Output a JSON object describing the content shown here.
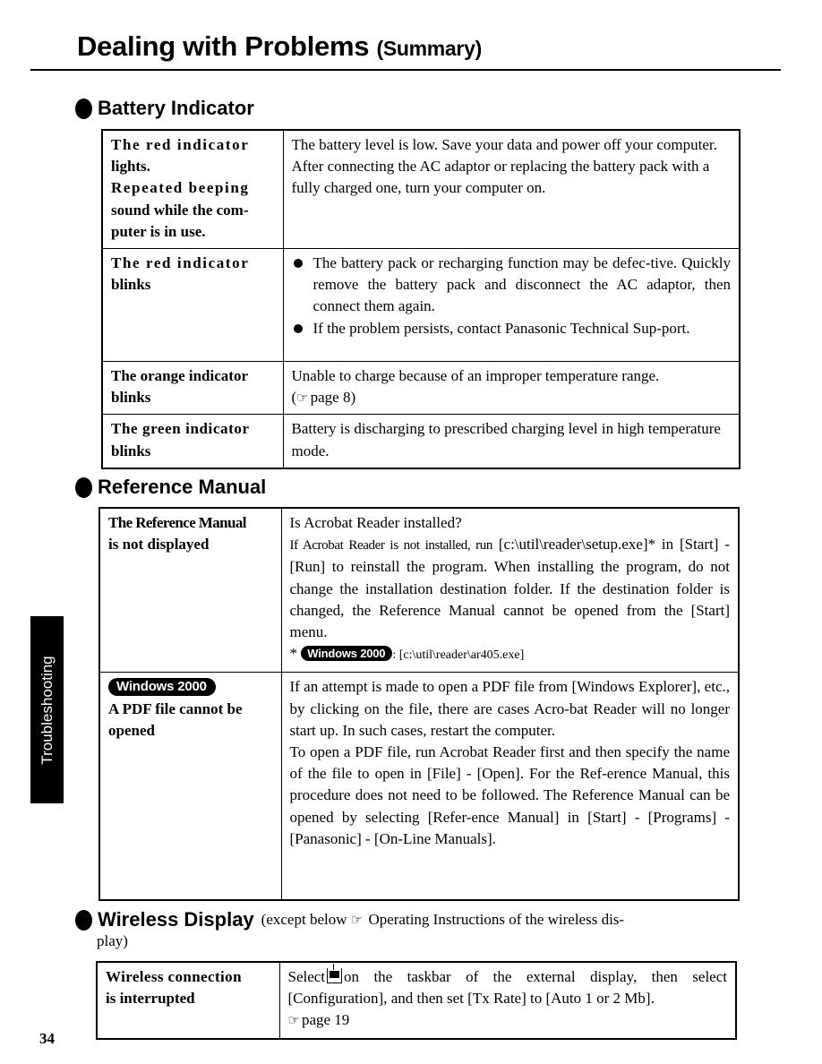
{
  "page": {
    "title": "Dealing with Problems",
    "title_suffix": "(Summary)",
    "side_tab": "Troubleshooting",
    "page_number": "34"
  },
  "icons": {
    "pointer": "☞",
    "windows_badge": "Windows 2000"
  },
  "battery": {
    "heading": "Battery Indicator",
    "rows": [
      {
        "issue_line1": "The red indicator",
        "issue_line2": "lights.",
        "issue_line3": "Repeated beeping",
        "issue_line4": "sound while the com-puter is in use.",
        "solution_p1": "The battery level is low.  Save your data and power off your computer.",
        "solution_p2": "After connecting the AC adaptor or replacing the battery pack with a fully charged one, turn your computer on."
      },
      {
        "issue_line1": "The red indicator",
        "issue_line2": "blinks",
        "bullets": [
          "The battery pack or recharging function may be defec-tive.  Quickly remove the battery pack and disconnect the AC adaptor, then connect them again.",
          "If the problem persists, contact Panasonic Technical Sup-port."
        ]
      },
      {
        "issue_line1": "The orange indicator",
        "issue_line2": "blinks",
        "solution_p1": "Unable to charge because of an improper temperature range.",
        "solution_ref": "page 8"
      },
      {
        "issue_line1": "The green indicator",
        "issue_line2": "blinks",
        "solution_p1": "Battery is discharging to prescribed charging level in high temperature mode."
      }
    ]
  },
  "reference": {
    "heading": "Reference Manual",
    "rows": [
      {
        "issue_line1": "The Reference Manual",
        "issue_line2": "is not displayed",
        "solution_p1": "Is Acrobat Reader installed?",
        "solution_p2a": "If Acrobat Reader is not installed, run",
        "solution_p2b": " [c:\\util\\reader\\setup.exe]* in [Start] - [Run] to reinstall the program.  When installing the program, do not change the installation destination folder.  If the destination folder is changed, the Reference Manual cannot be opened from the [Start] menu.",
        "footnote_mark": "*",
        "footnote_path": ": [c:\\util\\reader\\ar405.exe]"
      },
      {
        "issue_line2": "A PDF file cannot be opened",
        "solution_p1": "If an attempt is made to open a PDF file from [Windows Explorer], etc., by clicking on the file, there are cases Acro-bat Reader will no longer start up.  In such cases, restart the computer.",
        "solution_p2": "To open a PDF file, run Acrobat Reader first and then specify the name of the file to open in [File] - [Open].  For the Ref-erence Manual, this procedure does not need to be followed.  The Reference Manual can be opened by selecting [Refer-ence Manual] in [Start] - [Programs] - [Panasonic] - [On-Line Manuals]."
      }
    ]
  },
  "wireless": {
    "heading": "Wireless Display",
    "note_prefix": "(except below",
    "note_suffix": "Operating Instructions of the wireless dis-",
    "note_cont": "play)",
    "rows": [
      {
        "issue_line1": "Wireless connection",
        "issue_line2": "is interrupted",
        "solution_a": "Select",
        "solution_b": "on the taskbar of the external display, then select [Configuration], and then set [Tx Rate] to [Auto 1 or 2 Mb].",
        "solution_ref": "page 19"
      }
    ]
  }
}
